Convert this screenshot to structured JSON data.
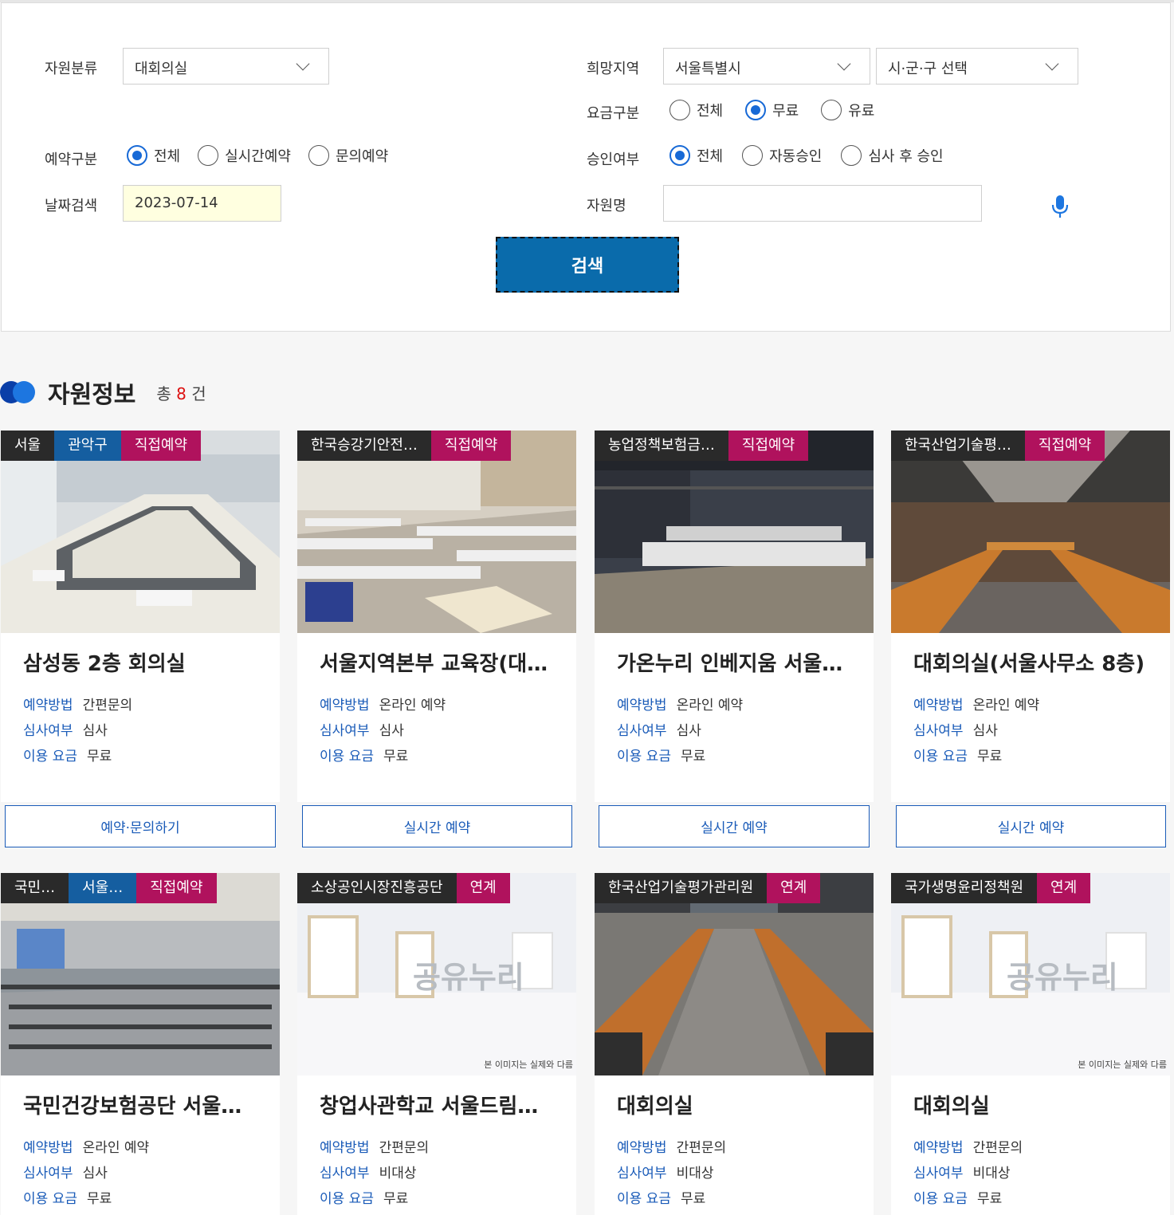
{
  "filters": {
    "resource_type_label": "자원분류",
    "resource_type_value": "대회의실",
    "region_label": "희망지역",
    "region_value": "서울특별시",
    "district_value": "시·군·구 선택",
    "fee_label": "요금구분",
    "fee_options": [
      "전체",
      "무료",
      "유료"
    ],
    "fee_selected": "무료",
    "reserve_label": "예약구분",
    "reserve_options": [
      "전체",
      "실시간예약",
      "문의예약"
    ],
    "reserve_selected": "전체",
    "approval_label": "승인여부",
    "approval_options": [
      "전체",
      "자동승인",
      "심사 후 승인"
    ],
    "approval_selected": "전체",
    "date_label": "날짜검색",
    "date_value": "2023-07-14",
    "name_label": "자원명",
    "name_value": "",
    "search_button": "검색"
  },
  "results": {
    "title": "자원정보",
    "count_prefix": "총",
    "count": "8",
    "count_suffix": "건"
  },
  "info_keys": {
    "method": "예약방법",
    "review": "심사여부",
    "fee": "이용 요금"
  },
  "cards": [
    {
      "tags": [
        "서울",
        "관악구",
        "직접예약"
      ],
      "title": "삼성동 2층 회의실",
      "method": "간편문의",
      "review": "심사",
      "fee": "무료",
      "button": "예약·문의하기",
      "photo": "meeting-room-tables"
    },
    {
      "tags": [
        "한국승강기안전…",
        "직접예약"
      ],
      "title": "서울지역본부 교육장(대…",
      "method": "온라인 예약",
      "review": "심사",
      "fee": "무료",
      "button": "실시간 예약",
      "photo": "classroom"
    },
    {
      "tags": [
        "농업정책보험금…",
        "직접예약"
      ],
      "title": "가온누리 인베지움 서울…",
      "method": "온라인 예약",
      "review": "심사",
      "fee": "무료",
      "button": "실시간 예약",
      "photo": "dark-conference"
    },
    {
      "tags": [
        "한국산업기술평…",
        "직접예약"
      ],
      "title": "대회의실(서울사무소 8층)",
      "method": "온라인 예약",
      "review": "심사",
      "fee": "무료",
      "button": "실시간 예약",
      "photo": "board-room"
    },
    {
      "tags": [
        "국민…",
        "서울…",
        "직접예약"
      ],
      "title": "국민건강보험공단 서울…",
      "method": "온라인 예약",
      "review": "심사",
      "fee": "무료",
      "photo": "auditorium"
    },
    {
      "tags": [
        "소상공인시장진흥공단",
        "연계"
      ],
      "title": "창업사관학교 서울드림…",
      "method": "간편문의",
      "review": "비대상",
      "fee": "무료",
      "photo": "placeholder",
      "watermark": "공유누리",
      "disclaimer": "본 이미지는 실제와 다름"
    },
    {
      "tags": [
        "한국산업기술평가관리원",
        "연계"
      ],
      "title": "대회의실",
      "method": "간편문의",
      "review": "비대상",
      "fee": "무료",
      "photo": "long-conference"
    },
    {
      "tags": [
        "국가생명윤리정책원",
        "연계"
      ],
      "title": "대회의실",
      "method": "간편문의",
      "review": "비대상",
      "fee": "무료",
      "photo": "placeholder",
      "watermark": "공유누리",
      "disclaimer": "본 이미지는 실제와 다름"
    }
  ],
  "colors": {
    "accent": "#0a6bab",
    "tag_pink": "#b0125d",
    "tag_blue": "#155ea0",
    "link_blue": "#1a5bb8"
  }
}
